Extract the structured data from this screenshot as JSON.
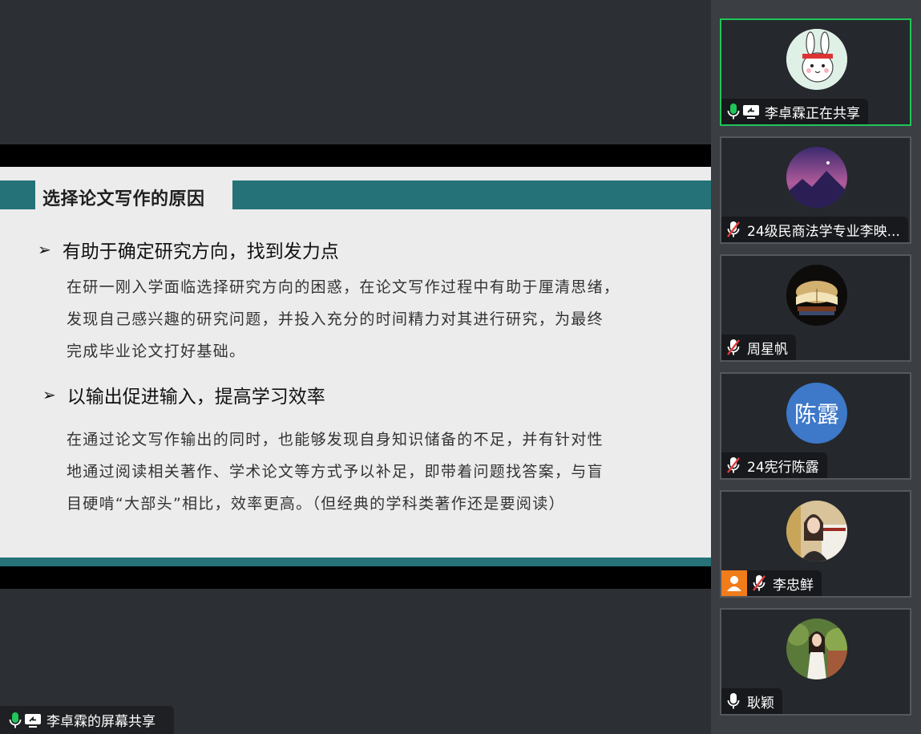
{
  "slide": {
    "title": "选择论文写作的原因",
    "bullet1": "有助于确定研究方向，找到发力点",
    "para1": [
      "在研一刚入学面临选择研究方向的困惑，在论文写作过程中有助于厘清思绪，",
      "发现自己感兴趣的研究问题，并投入充分的时间精力对其进行研究，为最终",
      "完成毕业论文打好基础。"
    ],
    "bullet2": "以输出促进输入，提高学习效率",
    "para2": [
      "在通过论文写作输出的同时，也能够发现自身知识储备的不足，并有针对性",
      "地通过阅读相关著作、学术论文等方式予以补足，即带着问题找答案，与盲",
      "目硬啃“大部头”相比，效率更高。（但经典的学科类著作还是要阅读）"
    ],
    "bullet_glyph": "➢"
  },
  "share_label": "李卓霖的屏幕共享",
  "participants": [
    {
      "name": "李卓霖正在共享",
      "mic": "on",
      "sharing": true,
      "active": true,
      "avatar": "rabbit-avatar"
    },
    {
      "name": "24级民商法学专业李映...",
      "mic": "muted",
      "avatar": "mountain-avatar"
    },
    {
      "name": "周星帆",
      "mic": "muted",
      "avatar": "book-avatar"
    },
    {
      "name": "24宪行陈露",
      "mic": "muted",
      "avatar_text": "陈露",
      "avatar_color": "#3d78c9"
    },
    {
      "name": "李忠鲜",
      "mic": "muted",
      "host_badge": true,
      "avatar": "presenter-photo-avatar"
    },
    {
      "name": "耿颖",
      "mic": "on",
      "avatar": "portrait-avatar"
    }
  ],
  "colors": {
    "accent": "#257378",
    "active_border": "#1fc65a",
    "muted_red": "#e23b3b",
    "mic_green": "#1fc65a",
    "host_orange": "#f07c1a"
  }
}
